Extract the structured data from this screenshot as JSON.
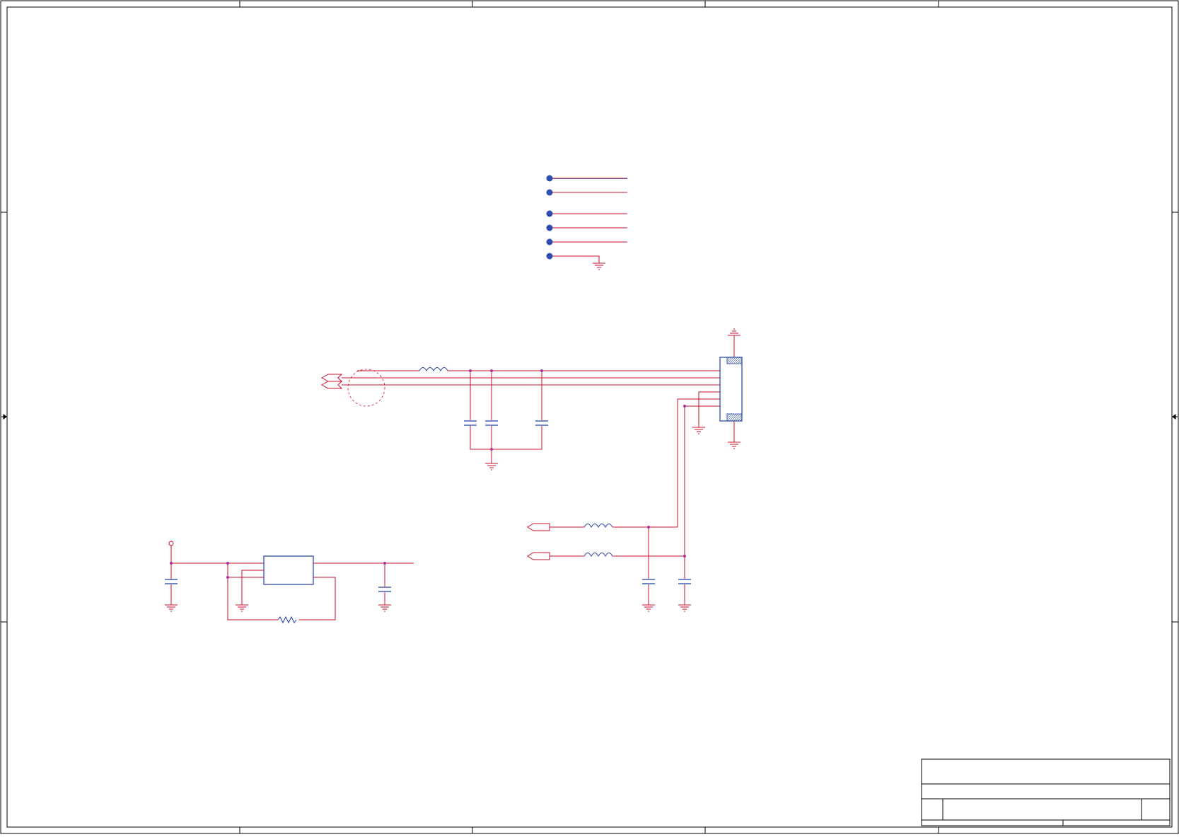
{
  "colors": {
    "wire": "#c8102e",
    "component": "#1f3fa0",
    "junction": "#b0309a",
    "border": "#000000",
    "test_point": "#2f4fb0",
    "background": "#ffffff"
  },
  "icons": {
    "ground": "ground-icon",
    "inductor": "inductor-icon",
    "capacitor": "capacitor-icon",
    "resistor": "resistor-icon",
    "test_point": "test-point-icon",
    "port": "port-icon",
    "connector": "connector-icon",
    "power_pin": "power-pin-icon",
    "regulator": "regulator-icon"
  }
}
